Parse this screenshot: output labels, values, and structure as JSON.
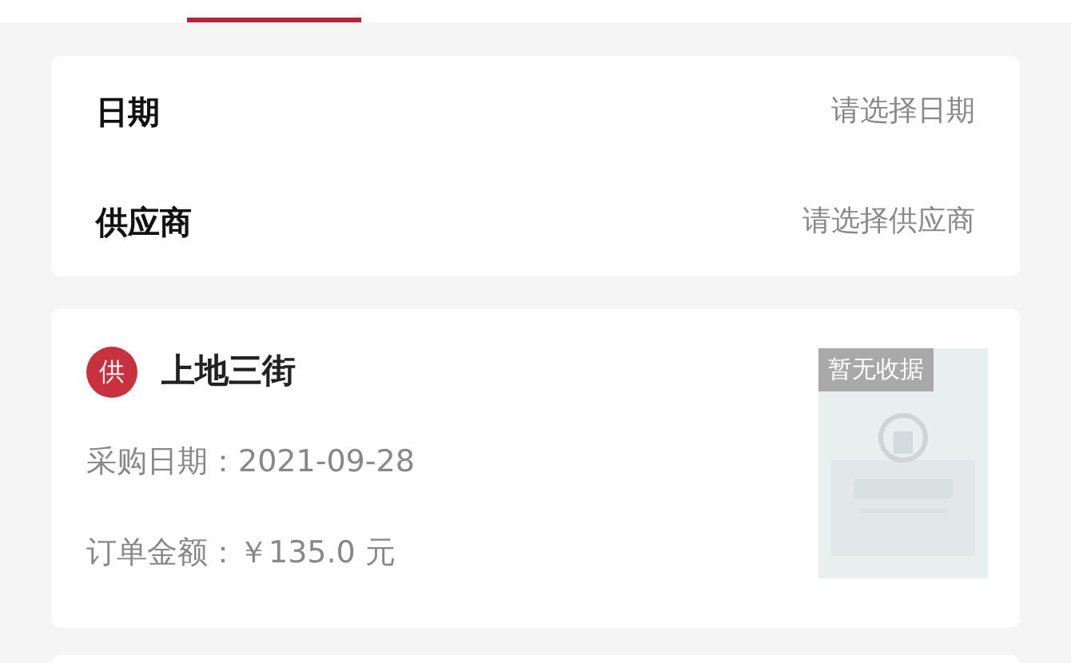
{
  "filters": [
    {
      "label": "日期",
      "placeholder": "请选择日期"
    },
    {
      "label": "供应商",
      "placeholder": "请选择供应商"
    }
  ],
  "orders": [
    {
      "badge": "供",
      "supplier": "上地三街",
      "lines": [
        "采购日期：2021-09-28",
        "订单金额：￥135.0 元"
      ],
      "receipt": {
        "kind": "picture",
        "tag": "暂无收据"
      }
    }
  ]
}
